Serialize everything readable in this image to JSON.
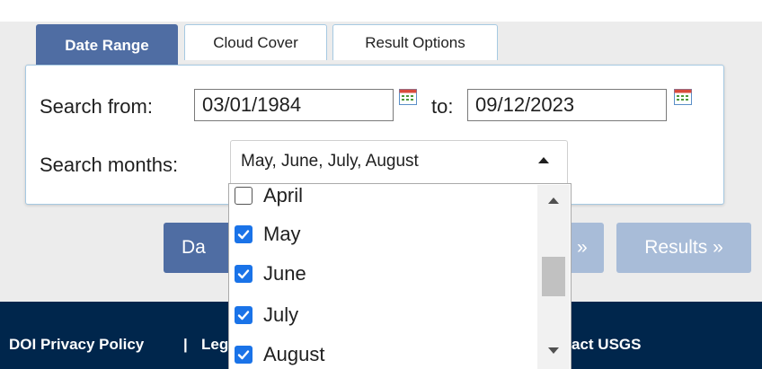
{
  "tabs": [
    {
      "label": "Date Range",
      "active": true
    },
    {
      "label": "Cloud Cover",
      "active": false
    },
    {
      "label": "Result Options",
      "active": false
    }
  ],
  "date_range": {
    "from_label": "Search from:",
    "from_value": "03/01/1984",
    "to_label": "to:",
    "to_value": "09/12/2023",
    "calendar_icon": "calendar-icon"
  },
  "months": {
    "label": "Search months:",
    "selected_text": "May, June, July, August",
    "options": [
      {
        "label": "April",
        "checked": false
      },
      {
        "label": "May",
        "checked": true
      },
      {
        "label": "June",
        "checked": true
      },
      {
        "label": "July",
        "checked": true
      },
      {
        "label": "August",
        "checked": true
      }
    ]
  },
  "nav_buttons": {
    "date_partial": "Da",
    "next_partial": "»",
    "results": "Results »"
  },
  "footer": {
    "privacy": "DOI Privacy Policy",
    "separator": "|",
    "legal_partial": "Leg",
    "contact_partial": "act USGS"
  },
  "colors": {
    "tab_active": "#4f6da3",
    "button_primary": "#4f6da3",
    "button_disabled": "#a8bcd8",
    "checkbox_checked": "#1a73e8",
    "footer_bg": "#00264c",
    "panel_border": "#a6c9e2"
  }
}
